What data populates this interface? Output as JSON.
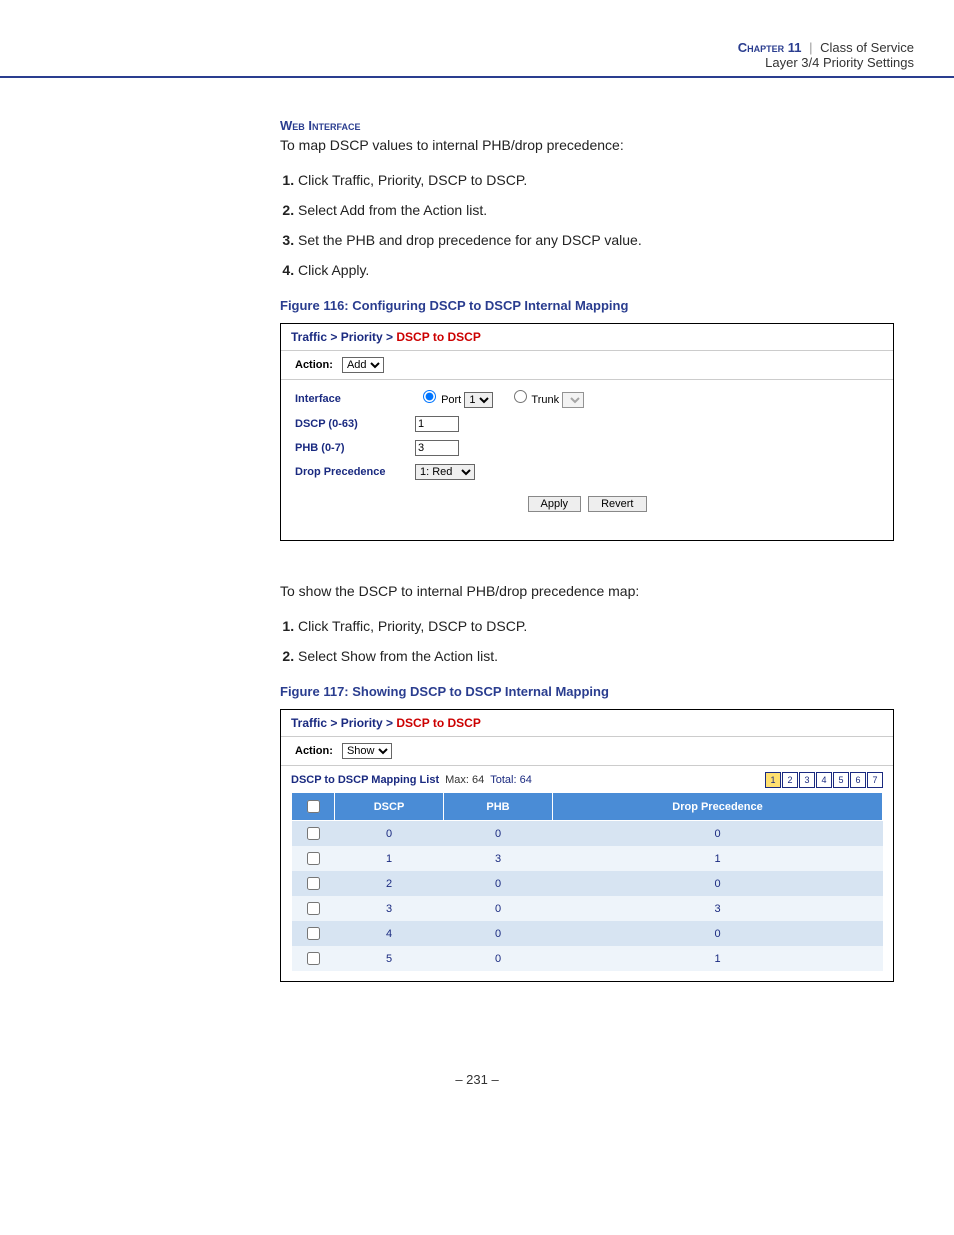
{
  "header": {
    "chapter_label": "Chapter 11",
    "section_title": "Class of Service",
    "subsection_title": "Layer 3/4 Priority Settings"
  },
  "section_heading": "Web Interface",
  "intro_map": "To map DSCP values to internal PHB/drop precedence:",
  "steps_map": [
    "Click Traffic, Priority, DSCP to DSCP.",
    "Select Add from the Action list.",
    "Set the PHB and drop precedence for any DSCP value.",
    "Click Apply."
  ],
  "figure116_caption": "Figure 116:  Configuring DSCP to DSCP Internal Mapping",
  "intro_show": "To show the DSCP to internal PHB/drop precedence map:",
  "steps_show": [
    "Click Traffic, Priority, DSCP to DSCP.",
    "Select Show from the Action list."
  ],
  "figure117_caption": "Figure 117:  Showing DSCP to DSCP Internal Mapping",
  "panel1": {
    "breadcrumb_prefix": "Traffic > Priority > ",
    "breadcrumb_last": "DSCP to DSCP",
    "action_label": "Action:",
    "action_value": "Add",
    "rows": {
      "interface_label": "Interface",
      "port_label": "Port",
      "port_value": "1",
      "trunk_label": "Trunk",
      "trunk_value": "",
      "dscp_label": "DSCP (0-63)",
      "dscp_value": "1",
      "phb_label": "PHB (0-7)",
      "phb_value": "3",
      "drop_label": "Drop Precedence",
      "drop_value": "1: Red"
    },
    "apply_label": "Apply",
    "revert_label": "Revert"
  },
  "panel2": {
    "breadcrumb_prefix": "Traffic > Priority > ",
    "breadcrumb_last": "DSCP to DSCP",
    "action_label": "Action:",
    "action_value": "Show",
    "list_title": "DSCP to DSCP Mapping List",
    "max_label": "Max: 64",
    "total_label": "Total: 64",
    "pages": [
      "1",
      "2",
      "3",
      "4",
      "5",
      "6",
      "7"
    ],
    "active_page": "1",
    "columns": [
      "",
      "DSCP",
      "PHB",
      "Drop Precedence"
    ],
    "rows": [
      {
        "dscp": "0",
        "phb": "0",
        "drop": "0"
      },
      {
        "dscp": "1",
        "phb": "3",
        "drop": "1"
      },
      {
        "dscp": "2",
        "phb": "0",
        "drop": "0"
      },
      {
        "dscp": "3",
        "phb": "0",
        "drop": "3"
      },
      {
        "dscp": "4",
        "phb": "0",
        "drop": "0"
      },
      {
        "dscp": "5",
        "phb": "0",
        "drop": "1"
      }
    ]
  },
  "page_number": "–  231  –"
}
